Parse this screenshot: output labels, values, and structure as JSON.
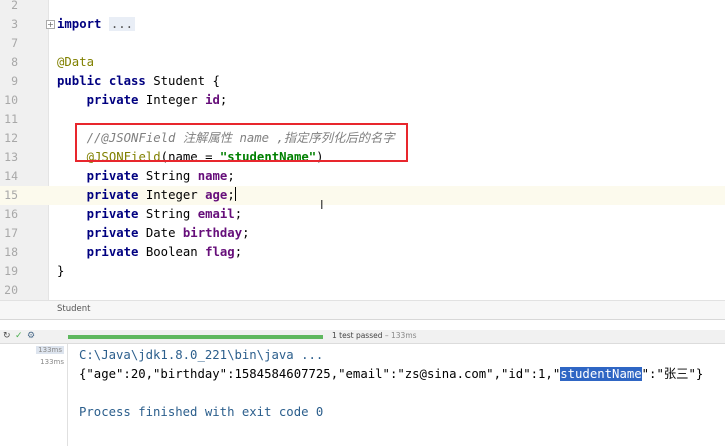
{
  "editor": {
    "fold_icon": "+",
    "lines": [
      {
        "num": "2",
        "tokens": []
      },
      {
        "num": "3",
        "fold": true,
        "tokens": [
          {
            "c": "kw",
            "t": "import "
          },
          {
            "c": "fold-txt",
            "t": "..."
          }
        ]
      },
      {
        "num": "7",
        "tokens": []
      },
      {
        "num": "8",
        "tokens": [
          {
            "c": "ann",
            "t": "@Data"
          }
        ]
      },
      {
        "num": "9",
        "tokens": [
          {
            "c": "kw",
            "t": "public class "
          },
          {
            "c": "",
            "t": "Student {"
          }
        ]
      },
      {
        "num": "10",
        "tokens": [
          {
            "c": "",
            "t": "    "
          },
          {
            "c": "kw",
            "t": "private "
          },
          {
            "c": "",
            "t": "Integer "
          },
          {
            "c": "fld",
            "t": "id"
          },
          {
            "c": "",
            "t": ";"
          }
        ]
      },
      {
        "num": "11",
        "tokens": []
      },
      {
        "num": "12",
        "tokens": [
          {
            "c": "",
            "t": "    "
          },
          {
            "c": "cmt",
            "t": "//@JSONField 注解属性 name ,指定序列化后的名字"
          }
        ]
      },
      {
        "num": "13",
        "tokens": [
          {
            "c": "",
            "t": "    "
          },
          {
            "c": "ann",
            "t": "@JSONField"
          },
          {
            "c": "",
            "t": "(name = "
          },
          {
            "c": "str",
            "t": "\"studentName\""
          },
          {
            "c": "",
            "t": ")"
          }
        ]
      },
      {
        "num": "14",
        "tokens": [
          {
            "c": "",
            "t": "    "
          },
          {
            "c": "kw",
            "t": "private "
          },
          {
            "c": "",
            "t": "String "
          },
          {
            "c": "fld",
            "t": "name"
          },
          {
            "c": "",
            "t": ";"
          }
        ]
      },
      {
        "num": "15",
        "current": true,
        "caret": true,
        "tokens": [
          {
            "c": "",
            "t": "    "
          },
          {
            "c": "kw",
            "t": "private "
          },
          {
            "c": "",
            "t": "Integer "
          },
          {
            "c": "fld",
            "t": "age"
          },
          {
            "c": "",
            "t": ";"
          }
        ]
      },
      {
        "num": "16",
        "tokens": [
          {
            "c": "",
            "t": "    "
          },
          {
            "c": "kw",
            "t": "private "
          },
          {
            "c": "",
            "t": "String "
          },
          {
            "c": "fld",
            "t": "email"
          },
          {
            "c": "",
            "t": ";"
          }
        ]
      },
      {
        "num": "17",
        "tokens": [
          {
            "c": "",
            "t": "    "
          },
          {
            "c": "kw",
            "t": "private "
          },
          {
            "c": "",
            "t": "Date "
          },
          {
            "c": "fld",
            "t": "birthday"
          },
          {
            "c": "",
            "t": ";"
          }
        ]
      },
      {
        "num": "18",
        "tokens": [
          {
            "c": "",
            "t": "    "
          },
          {
            "c": "kw",
            "t": "private "
          },
          {
            "c": "",
            "t": "Boolean "
          },
          {
            "c": "fld",
            "t": "flag"
          },
          {
            "c": "",
            "t": ";"
          }
        ]
      },
      {
        "num": "19",
        "tokens": [
          {
            "c": "",
            "t": "}"
          }
        ]
      },
      {
        "num": "20",
        "tokens": []
      }
    ],
    "highlight_color": "#e8262d",
    "ibeam": "I"
  },
  "breadcrumb": {
    "label": "Student"
  },
  "run": {
    "rerun_icon": "↻",
    "check_icon": "✓",
    "settings_icon": "⚙",
    "progress": 1.0,
    "status_text": "1 test passed",
    "status_time": " – 133ms",
    "tree": [
      {
        "label": "133ms",
        "selected": true
      },
      {
        "label": "133ms",
        "selected": false
      }
    ]
  },
  "console": {
    "command": "C:\\Java\\jdk1.8.0_221\\bin\\java ...",
    "output_parts": [
      {
        "t": "{\"age\":20,\"birthday\":1584584607725,\"email\":\"zs@sina.com\",\"id\":1,\"",
        "hl": false
      },
      {
        "t": "studentName",
        "hl": true
      },
      {
        "t": "\":\"张三\"}",
        "hl": false
      }
    ],
    "exit": "Process finished with exit code 0"
  }
}
